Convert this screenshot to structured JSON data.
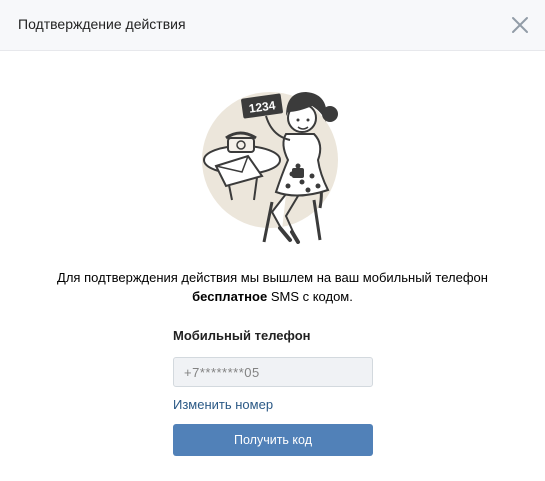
{
  "header": {
    "title": "Подтверждение действия",
    "close_icon": "close-icon"
  },
  "illustration": {
    "card_number": "1234",
    "icon": "woman-holding-sms-code-illustration"
  },
  "message": {
    "line1": "Для подтверждения действия мы вышлем на ваш мобильный телефон",
    "bold": "бесплатное",
    "rest": " SMS с кодом."
  },
  "form": {
    "phone_label": "Мобильный телефон",
    "phone_value": "+7********05",
    "change_link": "Изменить номер",
    "submit_label": "Получить код"
  },
  "colors": {
    "header_bg": "#f7f8fa",
    "button_bg": "#5181b8",
    "link": "#2a5885",
    "input_bg": "#f0f2f5",
    "illustration_bg": "#ece6db"
  }
}
